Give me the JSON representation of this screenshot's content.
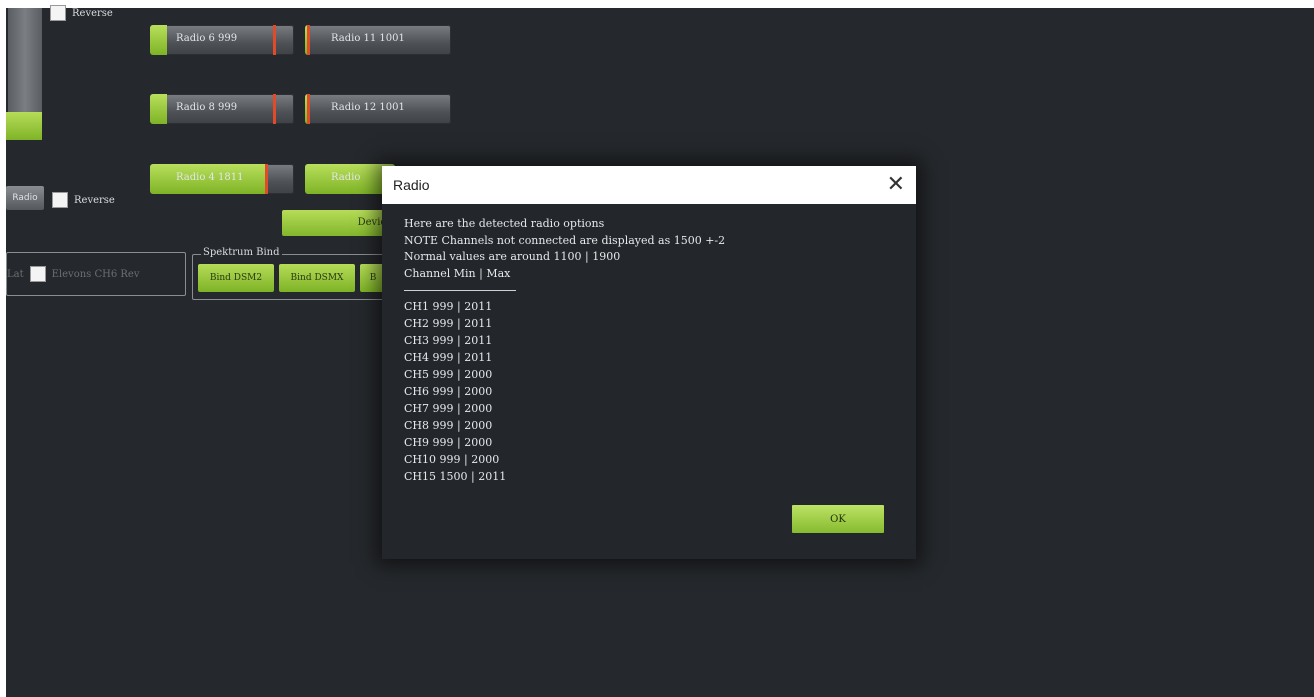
{
  "reverse_top": "Reverse",
  "reverse_mid": "Reverse",
  "radio_bars": [
    {
      "label": "Radio 6 999",
      "fill": 0.12,
      "marker": 0.87
    },
    {
      "label": "Radio 11 1001",
      "fill": 0.03,
      "marker": 0.03
    },
    {
      "label": "Radio 8 999",
      "fill": 0.12,
      "marker": 0.87
    },
    {
      "label": "Radio 12 1001",
      "fill": 0.03,
      "marker": 0.03
    },
    {
      "label": "Radio 4 1811",
      "fill": 0.82,
      "marker": 0.81
    },
    {
      "label": "Radio",
      "fill": 1.0,
      "marker": 1.0
    }
  ],
  "left_button": "Radio",
  "green_wide_btn": "Devic",
  "spektrum": {
    "title": "Spektrum Bind",
    "buttons": [
      "Bind DSM2",
      "Bind DSMX",
      "B"
    ]
  },
  "group_left": {
    "checkbox_label": "Elevons CH6 Rev",
    "prefix": "Lat"
  },
  "dialog": {
    "title": "Radio",
    "close": "✕",
    "intro": [
      "Here are the detected radio options",
      "NOTE Channels not connected are displayed as 1500 +-2",
      "Normal values are around 1100 | 1900",
      "Channel Min | Max"
    ],
    "channels": [
      "CH1 999 | 2011",
      "CH2 999 | 2011",
      "CH3 999 | 2011",
      "CH4 999 | 2011",
      "CH5 999 | 2000",
      "CH6 999 | 2000",
      "CH7 999 | 2000",
      "CH8 999 | 2000",
      "CH9 999 | 2000",
      "CH10 999 | 2000",
      "CH15 1500 | 2011"
    ],
    "ok": "OK"
  },
  "colors": {
    "background": "#25282c",
    "accent_green": "#9ccc40",
    "marker_red": "#e34a2a"
  }
}
